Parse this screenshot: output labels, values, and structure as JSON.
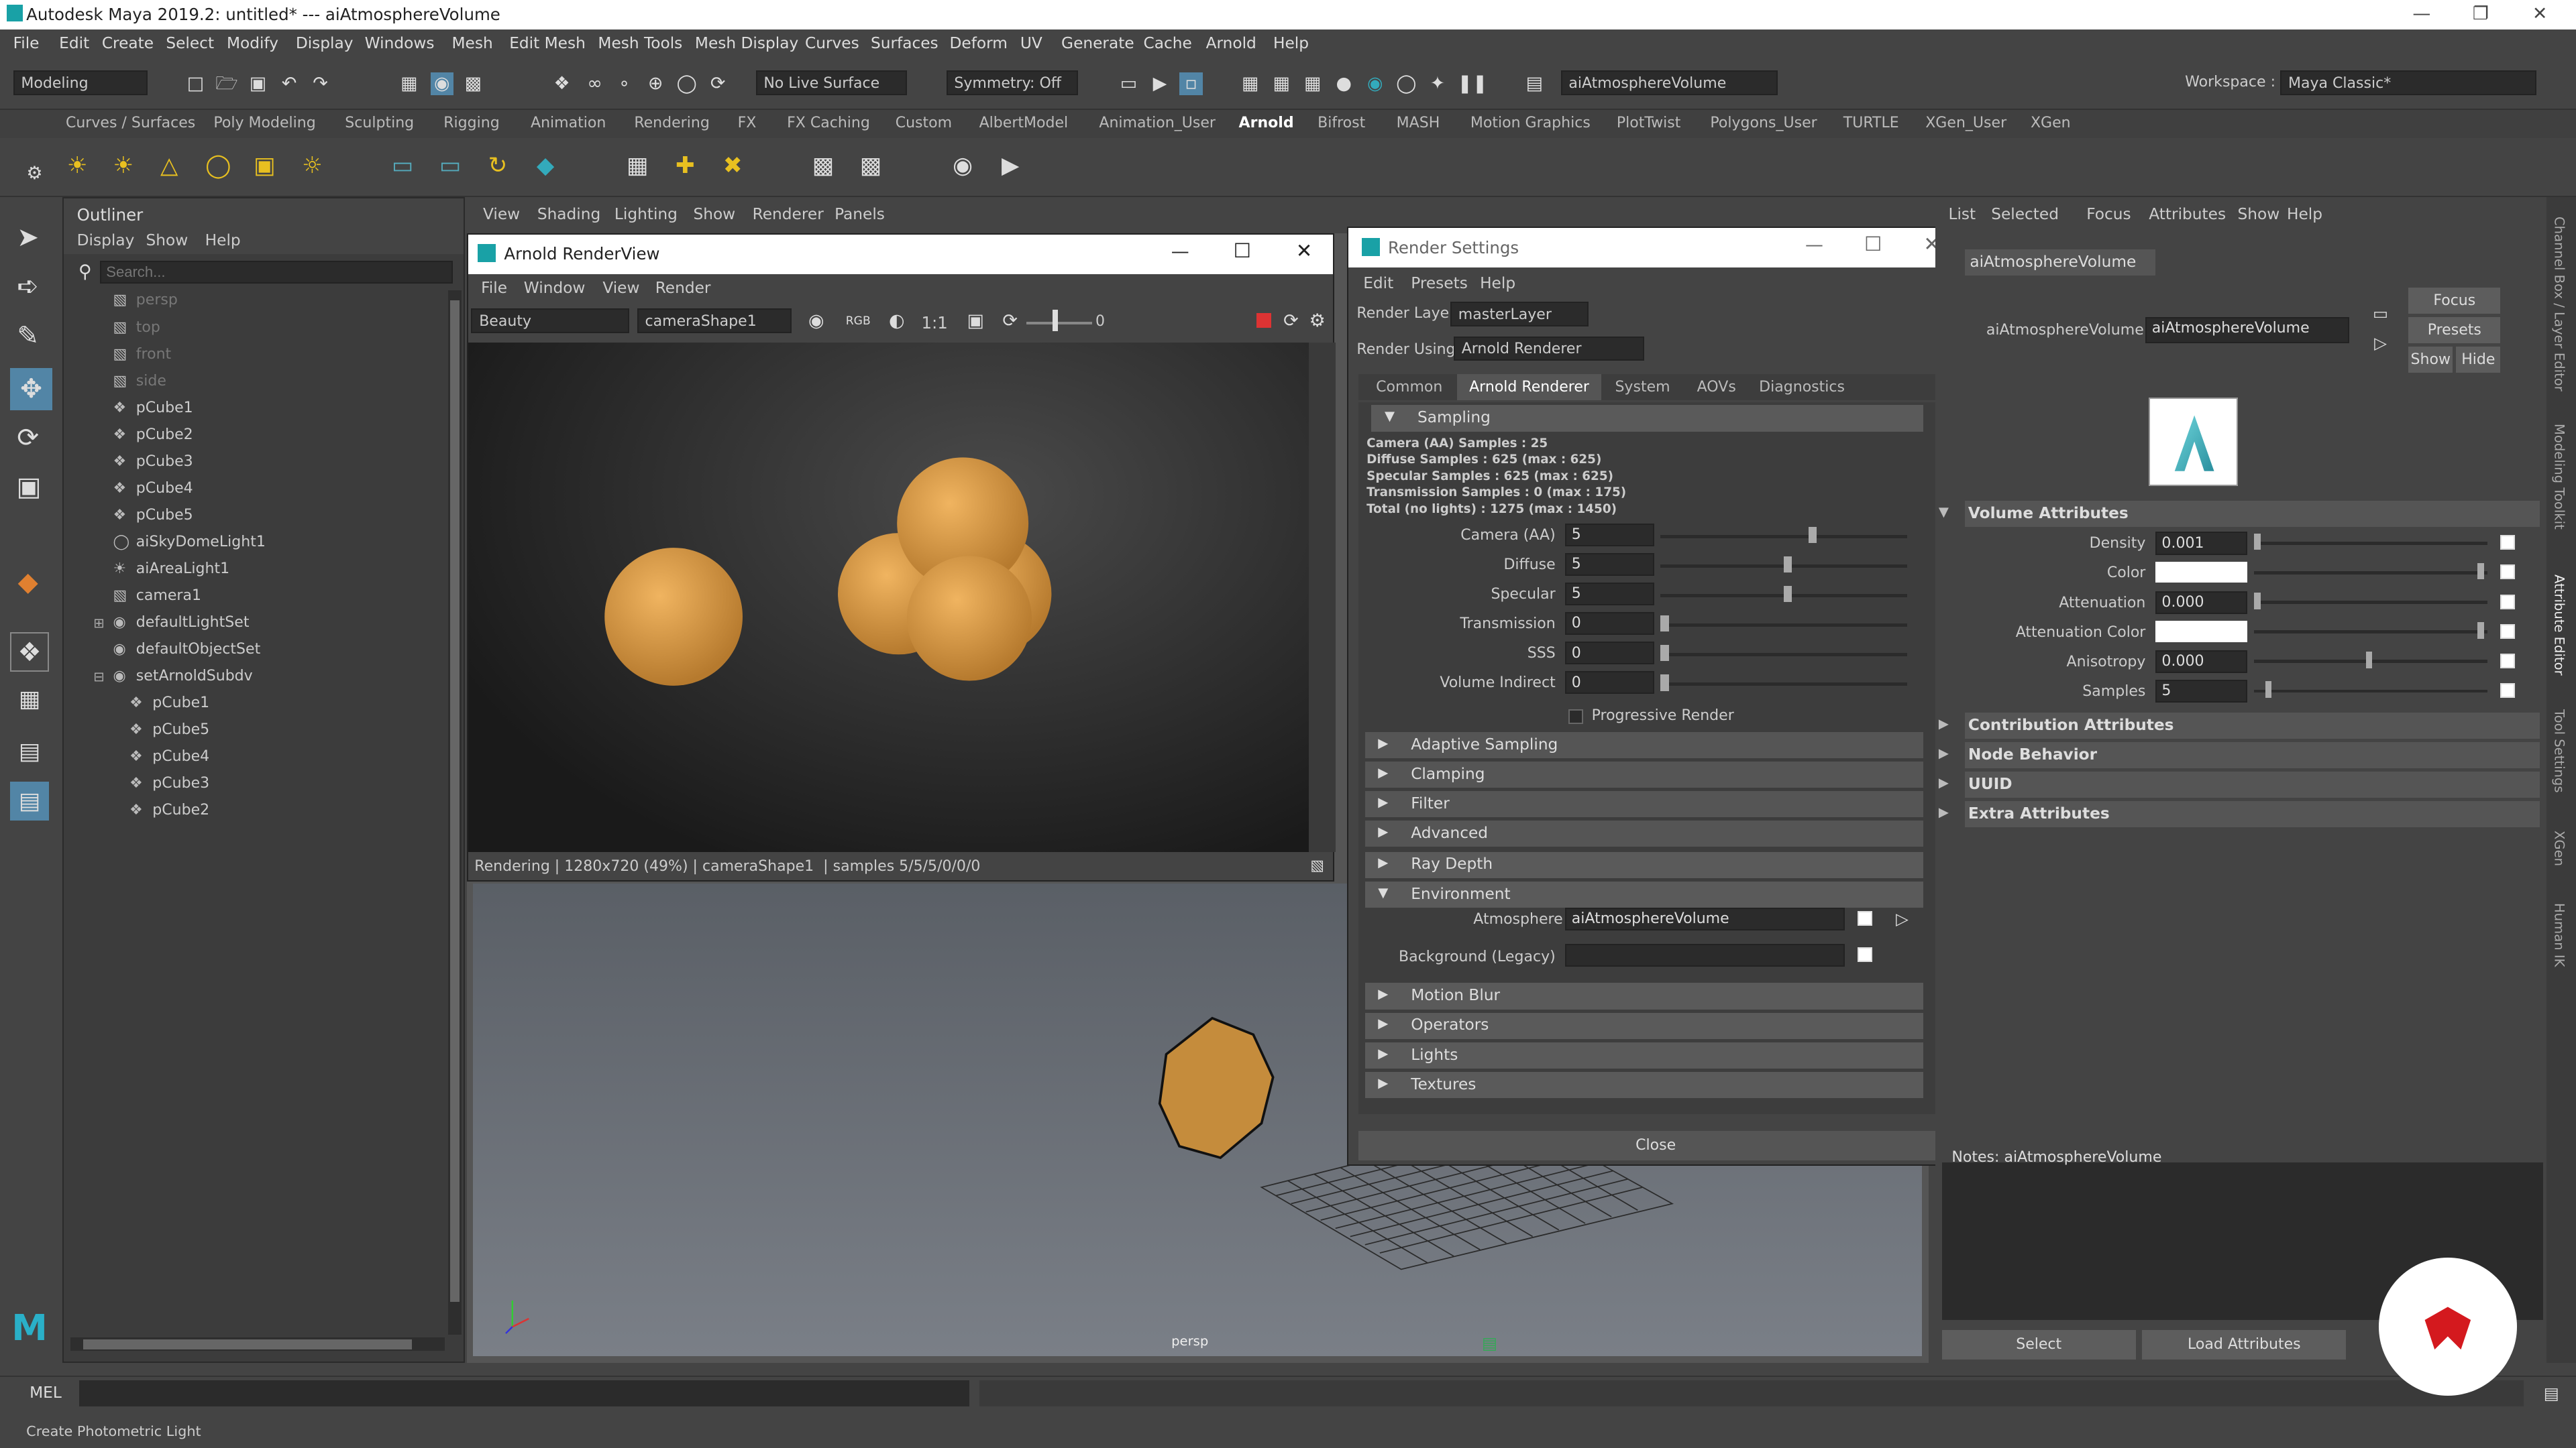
{
  "app": {
    "title": "Autodesk Maya 2019.2: untitled*   ---   aiAtmosphereVolume"
  },
  "menubar": [
    "File",
    "Edit",
    "Create",
    "Select",
    "Modify",
    "Display",
    "Windows",
    "Mesh",
    "Edit Mesh",
    "Mesh Tools",
    "Mesh Display",
    "Curves",
    "Surfaces",
    "Deform",
    "UV",
    "Generate",
    "Cache",
    "Arnold",
    "Help"
  ],
  "status": {
    "menuset": "Modeling",
    "live_surface": "No Live Surface",
    "symmetry": "Symmetry: Off",
    "search": "aiAtmosphereVolume",
    "workspace_label": "Workspace :",
    "workspace": "Maya Classic*"
  },
  "shelf_tabs": [
    "Curves / Surfaces",
    "Poly Modeling",
    "Sculpting",
    "Rigging",
    "Animation",
    "Rendering",
    "FX",
    "FX Caching",
    "Custom",
    "AlbertModel",
    "Animation_User",
    "Arnold",
    "Bifrost",
    "MASH",
    "Motion Graphics",
    "PlotTwist",
    "Polygons_User",
    "TURTLE",
    "XGen_User",
    "XGen"
  ],
  "outliner": {
    "title": "Outliner",
    "menu": [
      "Display",
      "Show",
      "Help"
    ],
    "search_placeholder": "Search...",
    "items": [
      {
        "label": "persp",
        "dim": true,
        "indent": 0
      },
      {
        "label": "top",
        "dim": true,
        "indent": 0
      },
      {
        "label": "front",
        "dim": true,
        "indent": 0
      },
      {
        "label": "side",
        "dim": true,
        "indent": 0
      },
      {
        "label": "pCube1",
        "indent": 0
      },
      {
        "label": "pCube2",
        "indent": 0
      },
      {
        "label": "pCube3",
        "indent": 0
      },
      {
        "label": "pCube4",
        "indent": 0
      },
      {
        "label": "pCube5",
        "indent": 0
      },
      {
        "label": "aiSkyDomeLight1",
        "indent": 0
      },
      {
        "label": "aiAreaLight1",
        "indent": 0
      },
      {
        "label": "camera1",
        "indent": 0
      },
      {
        "label": "defaultLightSet",
        "indent": 0
      },
      {
        "label": "defaultObjectSet",
        "indent": 0
      },
      {
        "label": "setArnoldSubdv",
        "indent": 0
      },
      {
        "label": "pCube1",
        "indent": 1
      },
      {
        "label": "pCube5",
        "indent": 1
      },
      {
        "label": "pCube4",
        "indent": 1
      },
      {
        "label": "pCube3",
        "indent": 1
      },
      {
        "label": "pCube2",
        "indent": 1
      }
    ]
  },
  "viewport": {
    "menu": [
      "View",
      "Shading",
      "Lighting",
      "Show",
      "Renderer",
      "Panels"
    ],
    "camera_label": "persp"
  },
  "renderview": {
    "title": "Arnold RenderView",
    "menu": [
      "File",
      "Window",
      "View",
      "Render"
    ],
    "aov": "Beauty",
    "camera": "cameraShape1",
    "ratio": "1:1",
    "exposure": "0",
    "status": "Rendering | 1280x720 (49%) | cameraShape1  | samples 5/5/5/0/0/0"
  },
  "render_settings": {
    "title": "Render Settings",
    "menu": [
      "Edit",
      "Presets",
      "Help"
    ],
    "render_layer_label": "Render Layer",
    "render_layer": "masterLayer",
    "render_using_label": "Render Using",
    "render_using": "Arnold Renderer",
    "tabs": [
      "Common",
      "Arnold Renderer",
      "System",
      "AOVs",
      "Diagnostics"
    ],
    "sampling_title": "Sampling",
    "sampling_info": [
      "Camera (AA) Samples : 25",
      "Diffuse Samples : 625 (max : 625)",
      "Specular Samples : 625 (max : 625)",
      "Transmission Samples : 0 (max : 175)",
      "Total (no lights) : 1275 (max : 1450)"
    ],
    "fields": [
      {
        "label": "Camera (AA)",
        "value": "5",
        "level": 0.6
      },
      {
        "label": "Diffuse",
        "value": "5",
        "level": 0.5
      },
      {
        "label": "Specular",
        "value": "5",
        "level": 0.5
      },
      {
        "label": "Transmission",
        "value": "0",
        "level": 0
      },
      {
        "label": "SSS",
        "value": "0",
        "level": 0
      },
      {
        "label": "Volume Indirect",
        "value": "0",
        "level": 0
      }
    ],
    "progressive": "Progressive Render",
    "subsections": [
      "Adaptive Sampling",
      "Clamping",
      "Filter",
      "Advanced"
    ],
    "sections_after": [
      "Ray Depth"
    ],
    "environment_title": "Environment",
    "atmosphere_label": "Atmosphere",
    "atmosphere_value": "aiAtmosphereVolume",
    "background_label": "Background (Legacy)",
    "sections_end": [
      "Motion Blur",
      "Operators",
      "Lights",
      "Textures"
    ],
    "close": "Close"
  },
  "attribute_editor": {
    "menu": [
      "List",
      "Selected",
      "Focus",
      "Attributes",
      "Show",
      "Help"
    ],
    "node_tab": "aiAtmosphereVolume",
    "node_label": "aiAtmosphereVolume:",
    "node_value": "aiAtmosphereVolume",
    "focus": "Focus",
    "presets": "Presets",
    "show": "Show",
    "hide": "Hide",
    "volume_title": "Volume Attributes",
    "attrs": [
      {
        "label": "Density",
        "value": "0.001",
        "level": 0.0
      },
      {
        "label": "Color",
        "swatch": "#ffffff",
        "level": 1.0
      },
      {
        "label": "Attenuation",
        "value": "0.000",
        "level": 0.0
      },
      {
        "label": "Attenuation Color",
        "swatch": "#ffffff",
        "level": 1.0
      },
      {
        "label": "Anisotropy",
        "value": "0.000",
        "level": 0.5
      },
      {
        "label": "Samples",
        "value": "5",
        "level": 0.05
      }
    ],
    "sections": [
      "Contribution Attributes",
      "Node Behavior",
      "UUID",
      "Extra Attributes"
    ],
    "notes": "Notes:  aiAtmosphereVolume",
    "select": "Select",
    "load": "Load Attributes"
  },
  "right_strip": [
    "Channel Box / Layer Editor",
    "Modeling Toolkit",
    "Attribute Editor",
    "Tool Settings",
    "XGen",
    "Human IK"
  ],
  "cmd": {
    "label": "MEL"
  },
  "help": {
    "text": "Create Photometric Light"
  },
  "colors": {
    "accent": "#5285a6",
    "sphere": "#c58c3c",
    "brand": "#d4191e"
  }
}
